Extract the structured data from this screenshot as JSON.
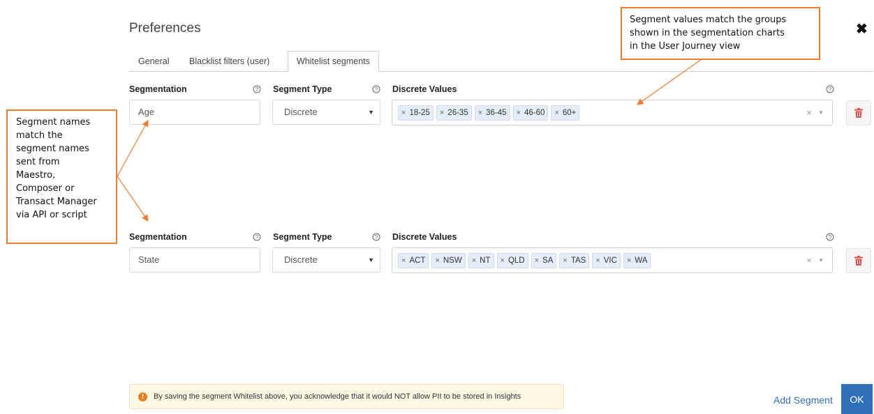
{
  "dialog": {
    "title": "Preferences"
  },
  "tabs": [
    {
      "label": "General",
      "active": false
    },
    {
      "label": "Blacklist filters (user)",
      "active": false
    },
    {
      "label": "Whitelist segments",
      "active": true
    }
  ],
  "columns": {
    "segmentation": "Segmentation",
    "segment_type": "Segment Type",
    "discrete_values": "Discrete Values",
    "help_glyph": "?"
  },
  "rows": [
    {
      "segmentation_value": "Age",
      "segment_type": "Discrete",
      "values": [
        "18-25",
        "26-35",
        "36-45",
        "46-60",
        "60+"
      ]
    },
    {
      "segmentation_value": "State",
      "segment_type": "Discrete",
      "values": [
        "ACT",
        "NSW",
        "NT",
        "QLD",
        "SA",
        "TAS",
        "VIC",
        "WA"
      ]
    }
  ],
  "annotations": {
    "left": [
      "Segment names",
      "match the",
      "segment names",
      "sent from",
      "Maestro,",
      "Composer or",
      "Transact Manager",
      "via API or script"
    ],
    "top": [
      "Segment values match the groups",
      "shown in the segmentation charts",
      "in the User Journey view"
    ]
  },
  "footer": {
    "warning": "By saving the segment Whitelist above, you acknowledge that it would NOT allow PII to be stored in Insights",
    "add_segment": "Add Segment",
    "ok": "OK"
  },
  "colors": {
    "accent": "#2f6fb5",
    "annotation_border": "#ed7d31",
    "delete_icon": "#d9534f",
    "warning_bg": "#fcf8e3"
  }
}
